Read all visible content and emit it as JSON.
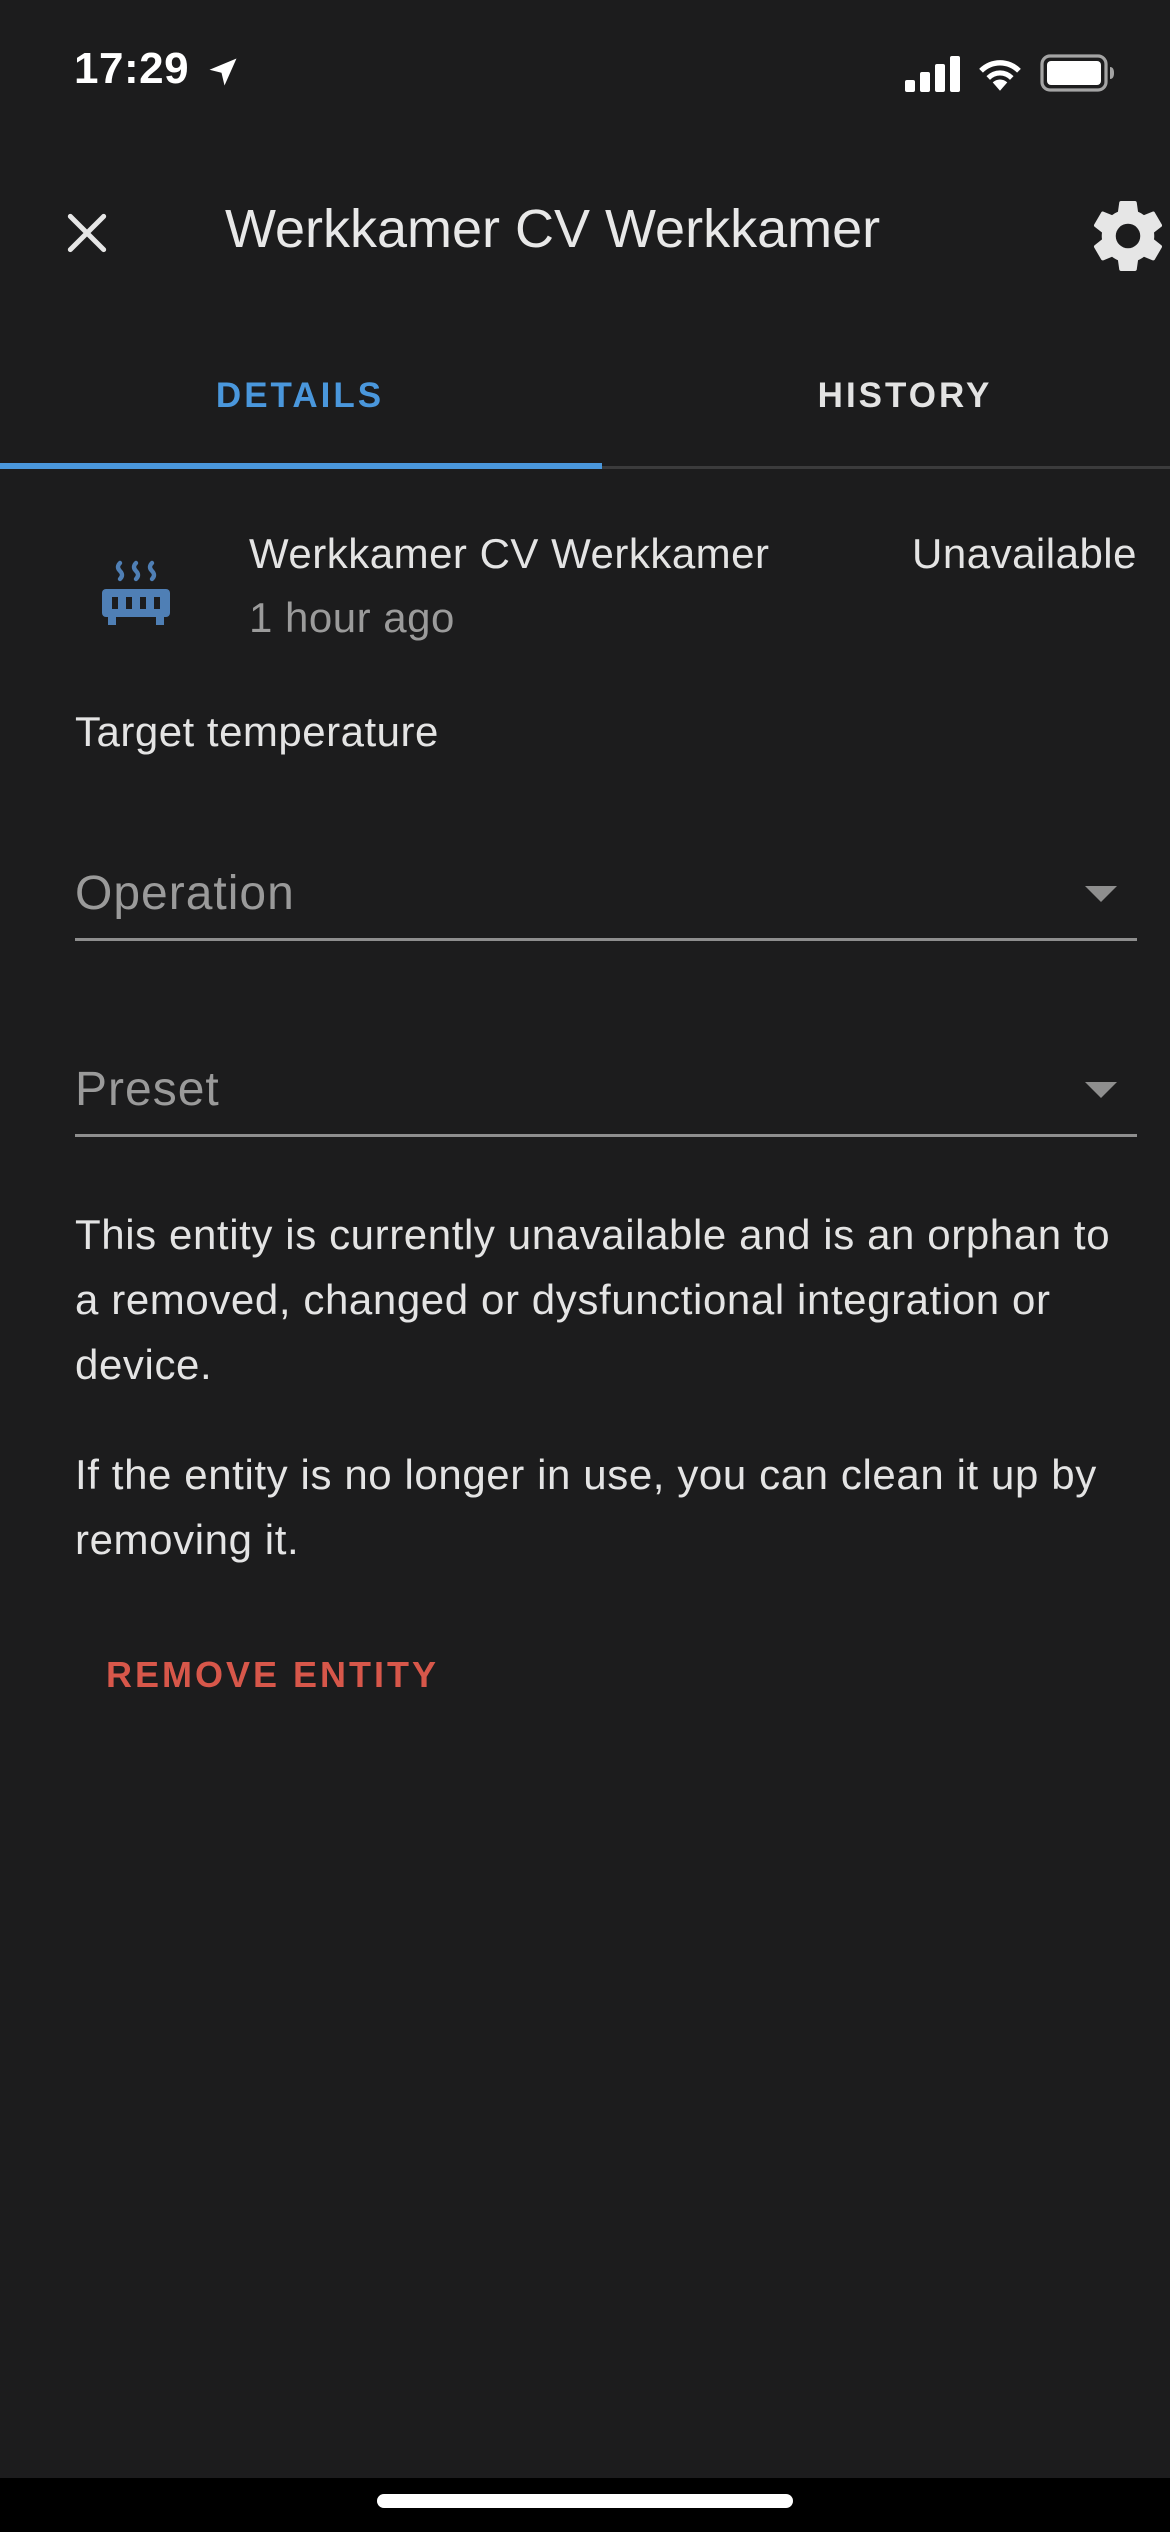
{
  "status_bar": {
    "time": "17:29",
    "icons": [
      "location-arrow-icon",
      "cellular-signal-icon",
      "wifi-icon",
      "battery-icon"
    ]
  },
  "header": {
    "title": "Werkkamer CV Werkkamer",
    "close_icon": "close-icon",
    "settings_icon": "gear-icon"
  },
  "tabs": [
    {
      "label": "DETAILS",
      "active": true
    },
    {
      "label": "HISTORY",
      "active": false
    }
  ],
  "entity": {
    "icon": "radiator-icon",
    "name": "Werkkamer CV Werkkamer",
    "last_changed": "1 hour ago",
    "state": "Unavailable"
  },
  "controls": {
    "target_label": "Target temperature",
    "operation_label": "Operation",
    "preset_label": "Preset"
  },
  "messages": {
    "orphan": "This entity is currently unavailable and is an orphan to a removed, changed or dysfunctional integration or device.",
    "cleanup": "If the entity is no longer in use, you can clean it up by removing it."
  },
  "actions": {
    "remove_label": "REMOVE ENTITY"
  },
  "colors": {
    "background": "#1c1c1d",
    "accent": "#4a97dc",
    "danger": "#d7574a",
    "icon": "#4f7fb5"
  }
}
